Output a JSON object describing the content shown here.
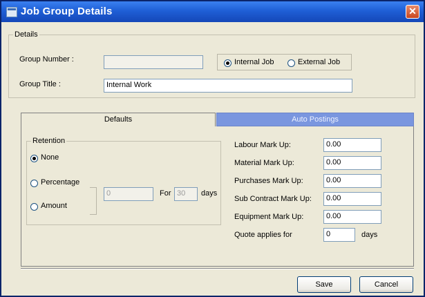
{
  "window": {
    "title": "Job Group Details",
    "close_glyph": "✕",
    "icon": "window-app-icon"
  },
  "details": {
    "caption": "Details",
    "group_number_label": "Group Number :",
    "group_number_value": "",
    "job_type": {
      "internal_label": "Internal Job",
      "external_label": "External Job",
      "selected": "internal"
    },
    "group_title_label": "Group Title :",
    "group_title_value": "Internal Work"
  },
  "tabs": [
    {
      "label": "Defaults",
      "active": true
    },
    {
      "label": "Auto Postings",
      "active": false
    }
  ],
  "retention": {
    "caption": "Retention",
    "options": [
      "None",
      "Percentage",
      "Amount"
    ],
    "selected": "None",
    "value": "0",
    "for_label": "For",
    "for_value": "30",
    "days_label": "days"
  },
  "markups": [
    {
      "label": "Labour Mark Up:",
      "value": "0.00"
    },
    {
      "label": "Material Mark Up:",
      "value": "0.00"
    },
    {
      "label": "Purchases Mark Up:",
      "value": "0.00"
    },
    {
      "label": "Sub Contract Mark Up:",
      "value": "0.00"
    },
    {
      "label": "Equipment Mark Up:",
      "value": "0.00"
    }
  ],
  "quote": {
    "label": "Quote applies for",
    "value": "0",
    "unit": "days"
  },
  "buttons": {
    "save": "Save",
    "cancel": "Cancel"
  }
}
